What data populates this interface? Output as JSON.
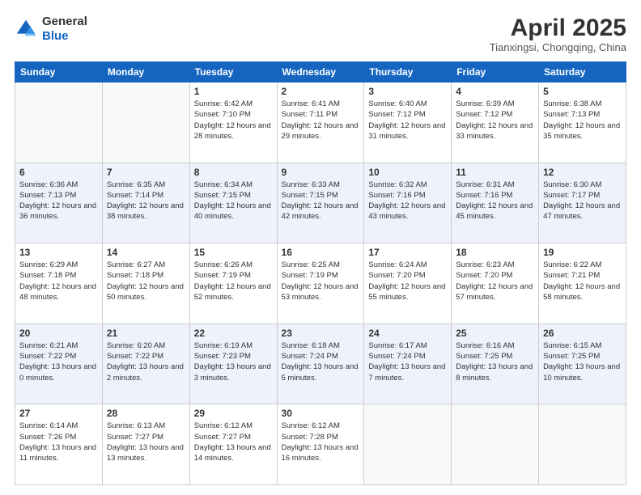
{
  "header": {
    "logo_line1": "General",
    "logo_line2": "Blue",
    "month_title": "April 2025",
    "location": "Tianxingsi, Chongqing, China"
  },
  "days_of_week": [
    "Sunday",
    "Monday",
    "Tuesday",
    "Wednesday",
    "Thursday",
    "Friday",
    "Saturday"
  ],
  "weeks": [
    [
      {
        "num": "",
        "info": ""
      },
      {
        "num": "",
        "info": ""
      },
      {
        "num": "1",
        "info": "Sunrise: 6:42 AM\nSunset: 7:10 PM\nDaylight: 12 hours and 28 minutes."
      },
      {
        "num": "2",
        "info": "Sunrise: 6:41 AM\nSunset: 7:11 PM\nDaylight: 12 hours and 29 minutes."
      },
      {
        "num": "3",
        "info": "Sunrise: 6:40 AM\nSunset: 7:12 PM\nDaylight: 12 hours and 31 minutes."
      },
      {
        "num": "4",
        "info": "Sunrise: 6:39 AM\nSunset: 7:12 PM\nDaylight: 12 hours and 33 minutes."
      },
      {
        "num": "5",
        "info": "Sunrise: 6:38 AM\nSunset: 7:13 PM\nDaylight: 12 hours and 35 minutes."
      }
    ],
    [
      {
        "num": "6",
        "info": "Sunrise: 6:36 AM\nSunset: 7:13 PM\nDaylight: 12 hours and 36 minutes."
      },
      {
        "num": "7",
        "info": "Sunrise: 6:35 AM\nSunset: 7:14 PM\nDaylight: 12 hours and 38 minutes."
      },
      {
        "num": "8",
        "info": "Sunrise: 6:34 AM\nSunset: 7:15 PM\nDaylight: 12 hours and 40 minutes."
      },
      {
        "num": "9",
        "info": "Sunrise: 6:33 AM\nSunset: 7:15 PM\nDaylight: 12 hours and 42 minutes."
      },
      {
        "num": "10",
        "info": "Sunrise: 6:32 AM\nSunset: 7:16 PM\nDaylight: 12 hours and 43 minutes."
      },
      {
        "num": "11",
        "info": "Sunrise: 6:31 AM\nSunset: 7:16 PM\nDaylight: 12 hours and 45 minutes."
      },
      {
        "num": "12",
        "info": "Sunrise: 6:30 AM\nSunset: 7:17 PM\nDaylight: 12 hours and 47 minutes."
      }
    ],
    [
      {
        "num": "13",
        "info": "Sunrise: 6:29 AM\nSunset: 7:18 PM\nDaylight: 12 hours and 48 minutes."
      },
      {
        "num": "14",
        "info": "Sunrise: 6:27 AM\nSunset: 7:18 PM\nDaylight: 12 hours and 50 minutes."
      },
      {
        "num": "15",
        "info": "Sunrise: 6:26 AM\nSunset: 7:19 PM\nDaylight: 12 hours and 52 minutes."
      },
      {
        "num": "16",
        "info": "Sunrise: 6:25 AM\nSunset: 7:19 PM\nDaylight: 12 hours and 53 minutes."
      },
      {
        "num": "17",
        "info": "Sunrise: 6:24 AM\nSunset: 7:20 PM\nDaylight: 12 hours and 55 minutes."
      },
      {
        "num": "18",
        "info": "Sunrise: 6:23 AM\nSunset: 7:20 PM\nDaylight: 12 hours and 57 minutes."
      },
      {
        "num": "19",
        "info": "Sunrise: 6:22 AM\nSunset: 7:21 PM\nDaylight: 12 hours and 58 minutes."
      }
    ],
    [
      {
        "num": "20",
        "info": "Sunrise: 6:21 AM\nSunset: 7:22 PM\nDaylight: 13 hours and 0 minutes."
      },
      {
        "num": "21",
        "info": "Sunrise: 6:20 AM\nSunset: 7:22 PM\nDaylight: 13 hours and 2 minutes."
      },
      {
        "num": "22",
        "info": "Sunrise: 6:19 AM\nSunset: 7:23 PM\nDaylight: 13 hours and 3 minutes."
      },
      {
        "num": "23",
        "info": "Sunrise: 6:18 AM\nSunset: 7:24 PM\nDaylight: 13 hours and 5 minutes."
      },
      {
        "num": "24",
        "info": "Sunrise: 6:17 AM\nSunset: 7:24 PM\nDaylight: 13 hours and 7 minutes."
      },
      {
        "num": "25",
        "info": "Sunrise: 6:16 AM\nSunset: 7:25 PM\nDaylight: 13 hours and 8 minutes."
      },
      {
        "num": "26",
        "info": "Sunrise: 6:15 AM\nSunset: 7:25 PM\nDaylight: 13 hours and 10 minutes."
      }
    ],
    [
      {
        "num": "27",
        "info": "Sunrise: 6:14 AM\nSunset: 7:26 PM\nDaylight: 13 hours and 11 minutes."
      },
      {
        "num": "28",
        "info": "Sunrise: 6:13 AM\nSunset: 7:27 PM\nDaylight: 13 hours and 13 minutes."
      },
      {
        "num": "29",
        "info": "Sunrise: 6:12 AM\nSunset: 7:27 PM\nDaylight: 13 hours and 14 minutes."
      },
      {
        "num": "30",
        "info": "Sunrise: 6:12 AM\nSunset: 7:28 PM\nDaylight: 13 hours and 16 minutes."
      },
      {
        "num": "",
        "info": ""
      },
      {
        "num": "",
        "info": ""
      },
      {
        "num": "",
        "info": ""
      }
    ]
  ]
}
